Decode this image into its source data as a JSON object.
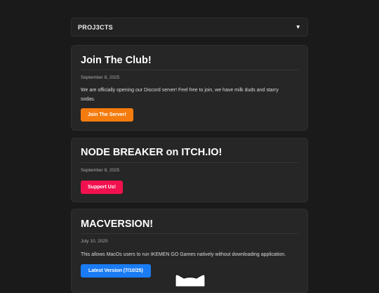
{
  "dropdown": {
    "label": "PROJ3CTS",
    "arrow_icon": "triangle-down"
  },
  "posts": [
    {
      "title": "Join The Club!",
      "date": "September 8, 2025",
      "body": "We are officially opening our Discord server! Feel free to join, we have milk duds and starry sodas.",
      "button": "Join The Server!",
      "button_color": "#f47c0f"
    },
    {
      "title": "NODE BREAKER on ITCH.IO!",
      "date": "September 8, 2025",
      "body": "",
      "button": "Support Us!",
      "button_color": "#f2114f"
    },
    {
      "title": "MACVERSION!",
      "date": "July 10, 2025",
      "body": "This allows MacOs users to run IKEMEN GO Games natively without downloading application.",
      "button": "Latest Version (7/10/25)",
      "button_color": "#1a7cf5"
    }
  ]
}
